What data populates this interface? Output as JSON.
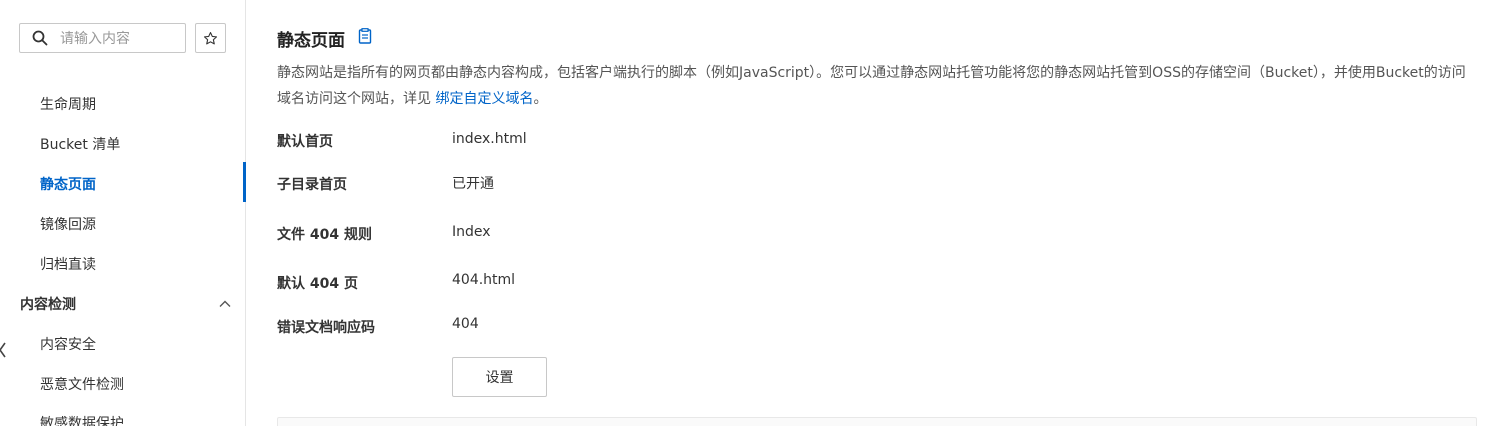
{
  "sidebar": {
    "search_placeholder": "请输入内容",
    "items": [
      {
        "label": "生命周期"
      },
      {
        "label": "Bucket 清单"
      },
      {
        "label": "静态页面"
      },
      {
        "label": "镜像回源"
      },
      {
        "label": "归档直读"
      }
    ],
    "group": {
      "label": "内容检测"
    },
    "group_items": [
      {
        "label": "内容安全"
      },
      {
        "label": "恶意文件检测"
      },
      {
        "label": "敏感数据保护"
      }
    ]
  },
  "main": {
    "title": "静态页面",
    "description": "静态网站是指所有的网页都由静态内容构成，包括客户端执行的脚本（例如JavaScript）。您可以通过静态网站托管功能将您的静态网站托管到OSS的存储空间（Bucket），并使用Bucket的访问域名访问这个网站，详见",
    "description_link": "绑定自定义域名",
    "description_end": "。",
    "rows": [
      {
        "label": "默认首页",
        "value": "index.html"
      },
      {
        "label": "子目录首页",
        "value": "已开通"
      },
      {
        "label": "文件 404 规则",
        "value": "Index"
      },
      {
        "label": "默认 404 页",
        "value": "404.html"
      },
      {
        "label": "错误文档响应码",
        "value": "404"
      }
    ],
    "settings_button": "设置"
  },
  "colors": {
    "accent": "#0064c8",
    "text": "#333333",
    "border": "#c8c8c8"
  }
}
